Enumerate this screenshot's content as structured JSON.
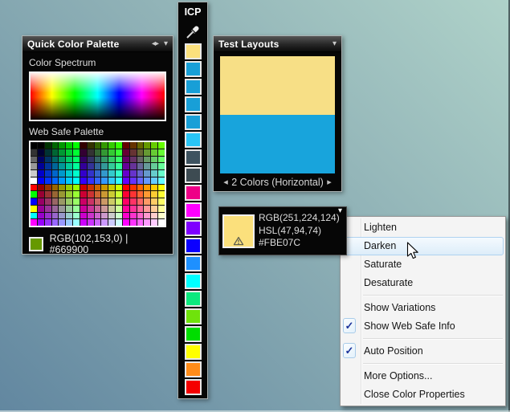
{
  "icons": {
    "check": "✓",
    "dropdown": "▾",
    "nav_left": "◂",
    "nav_right": "▸",
    "resize": "◂▸"
  },
  "quick_palette": {
    "title": "Quick Color Palette",
    "spectrum_label": "Color Spectrum",
    "websafe_label": "Web Safe Palette",
    "status_color": "#669900",
    "status_text": "RGB(102,153,0) | #669900",
    "palette_spec": {
      "rows": 12,
      "cols": 19,
      "special_column": [
        "#000000",
        "#333333",
        "#666666",
        "#999999",
        "#CCCCCC",
        "#FFFFFF",
        "#FF0000",
        "#00FF00",
        "#0000FF",
        "#FFFF00",
        "#00FFFF",
        "#FF00FF"
      ],
      "steps": [
        "00",
        "33",
        "66",
        "99",
        "CC",
        "FF"
      ]
    }
  },
  "icp_bar": {
    "title": "ICP",
    "swatches": [
      "#FBE07C",
      "#189FD7",
      "#189FD7",
      "#189FD7",
      "#189FD7",
      "#29C5F6",
      "#3E5360",
      "#3D4B52",
      "#EE0087",
      "#FF00FF",
      "#7F00FF",
      "#0B00FF",
      "#1E90FF",
      "#00FFFF",
      "#0CE97E",
      "#6FE30B",
      "#00DD00",
      "#FFFF00",
      "#FF8C19",
      "#F50000"
    ]
  },
  "test_layouts": {
    "title": "Test Layouts",
    "colors": [
      "#F7DF86",
      "#18A4DC"
    ],
    "nav_label": "2 Colors (Horizontal)"
  },
  "color_popup": {
    "swatch": "#FBE07C",
    "lines": [
      "RGB(251,224,124)",
      "HSL(47,94,74)",
      "#FBE07C"
    ]
  },
  "context_menu": {
    "items": [
      {
        "label": "Lighten"
      },
      {
        "label": "Darken",
        "highlighted": true
      },
      {
        "label": "Saturate"
      },
      {
        "label": "Desaturate",
        "sep_after": true
      },
      {
        "label": "Show Variations"
      },
      {
        "label": "Show Web Safe Info",
        "checked": true,
        "sep_after": true
      },
      {
        "label": "Auto Position",
        "checked": true,
        "sep_after": true
      },
      {
        "label": "More Options..."
      },
      {
        "label": "Close Color Properties"
      }
    ]
  }
}
